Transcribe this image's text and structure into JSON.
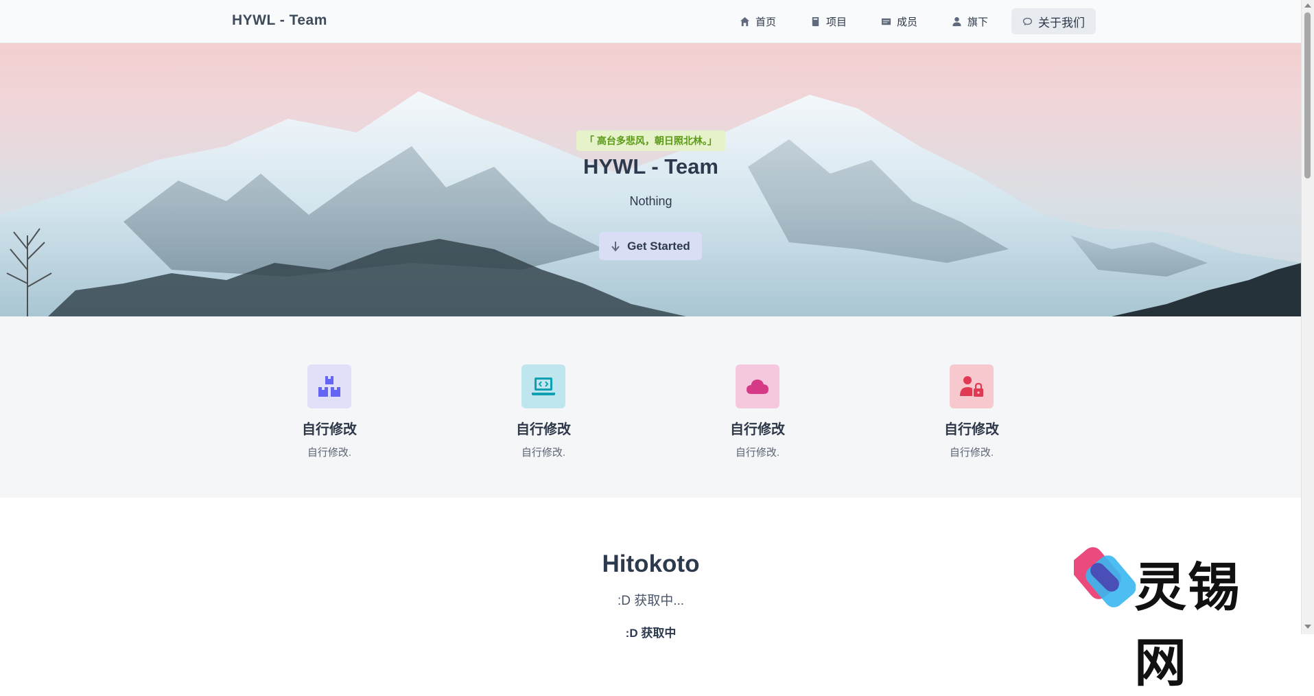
{
  "nav": {
    "brand": "HYWL - Team",
    "items": [
      {
        "label": "首页",
        "icon": "home-icon"
      },
      {
        "label": "项目",
        "icon": "book-icon"
      },
      {
        "label": "成员",
        "icon": "id-card-icon"
      },
      {
        "label": "旗下",
        "icon": "user-icon"
      },
      {
        "label": "关于我们",
        "icon": "comment-icon"
      }
    ]
  },
  "hero": {
    "quote": "「 高台多悲风，朝日照北林。」",
    "title": "HYWL - Team",
    "subtitle": "Nothing",
    "cta_label": "Get Started"
  },
  "features": [
    {
      "title": "自行修改",
      "desc": "自行修改.",
      "icon": "boxes-icon",
      "color": "#6366f1",
      "bg": "#e0e0fa"
    },
    {
      "title": "自行修改",
      "desc": "自行修改.",
      "icon": "laptop-code-icon",
      "color": "#0e9fb3",
      "bg": "#bfe6ee"
    },
    {
      "title": "自行修改",
      "desc": "自行修改.",
      "icon": "cloud-icon",
      "color": "#d63a86",
      "bg": "#f5c8dd"
    },
    {
      "title": "自行修改",
      "desc": "自行修改.",
      "icon": "user-lock-icon",
      "color": "#e03a53",
      "bg": "#f7c9cf"
    }
  ],
  "hitokoto": {
    "title": "Hitokoto",
    "text": ":D 获取中...",
    "text2": ":D 获取中"
  },
  "watermark": {
    "text": "灵锡网"
  }
}
